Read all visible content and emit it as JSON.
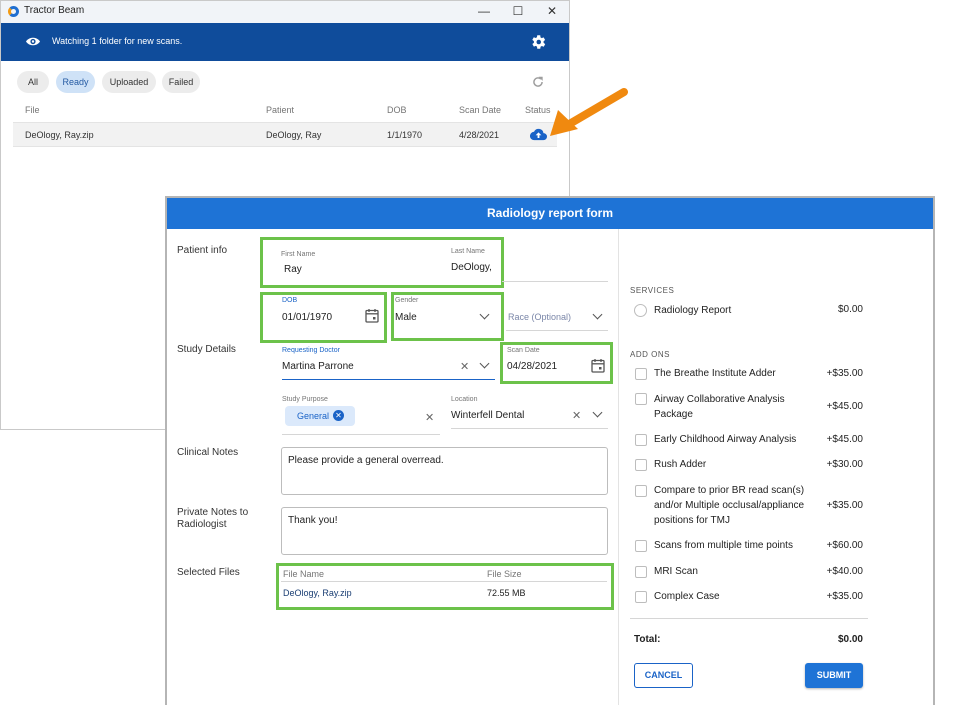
{
  "tractor_beam": {
    "window_title": "Tractor Beam",
    "window_controls": {
      "minimize": "—",
      "maximize": "☐",
      "close": "✕"
    },
    "status_text": "Watching 1 folder for new scans.",
    "filters": [
      "All",
      "Ready",
      "Uploaded",
      "Failed"
    ],
    "active_filter": "Ready",
    "columns": [
      "File",
      "Patient",
      "DOB",
      "Scan Date",
      "Status"
    ],
    "rows": [
      {
        "file": "DeOlogy, Ray.zip",
        "patient": "DeOlogy, Ray",
        "dob": "1/1/1970",
        "scan_date": "4/28/2021",
        "status_icon": "cloud-upload-icon"
      }
    ],
    "icons": {
      "watch": "eye-icon",
      "settings": "gear-icon",
      "refresh": "refresh-icon",
      "callout": "arrow-pointer"
    },
    "colors": {
      "app_bar": "#0f4c9b",
      "callout_arrow": "#f0890f"
    }
  },
  "form": {
    "title": "Radiology report form",
    "sections": {
      "patient_info": "Patient info",
      "study_details": "Study Details",
      "clinical_notes": "Clinical Notes",
      "private_notes": "Private Notes to Radiologist",
      "selected_files": "Selected Files"
    },
    "patient": {
      "first_name_label": "First Name",
      "first_name": "Ray",
      "last_name_label": "Last Name",
      "last_name": "DeOlogy,",
      "dob_label": "DOB",
      "dob": "01/01/1970",
      "gender_label": "Gender",
      "gender": "Male",
      "race_placeholder": "Race (Optional)"
    },
    "study": {
      "doctor_label": "Requesting Doctor",
      "doctor": "Martina Parrone",
      "scan_date_label": "Scan Date",
      "scan_date": "04/28/2021",
      "purpose_label": "Study Purpose",
      "purpose_chip": "General",
      "location_label": "Location",
      "location": "Winterfell Dental"
    },
    "clinical_notes": "Please provide a general overread.",
    "private_notes": "Thank you!",
    "files": {
      "columns": [
        "File Name",
        "File Size"
      ],
      "rows": [
        {
          "name": "DeOlogy, Ray.zip",
          "size": "72.55 MB"
        }
      ]
    },
    "services_heading": "SERVICES",
    "services": [
      {
        "label": "Radiology Report",
        "price": "$0.00"
      }
    ],
    "addons_heading": "ADD ONS",
    "addons": [
      {
        "label": "The Breathe Institute Adder",
        "price": "+$35.00"
      },
      {
        "label": "Airway Collaborative Analysis Package",
        "price": "+$45.00"
      },
      {
        "label": "Early Childhood Airway Analysis",
        "price": "+$45.00"
      },
      {
        "label": "Rush Adder",
        "price": "+$30.00"
      },
      {
        "label": "Compare to prior BR read scan(s) and/or Multiple occlusal/appliance positions for TMJ",
        "price": "+$35.00"
      },
      {
        "label": "Scans from multiple time points",
        "price": "+$60.00"
      },
      {
        "label": "MRI Scan",
        "price": "+$40.00"
      },
      {
        "label": "Complex Case",
        "price": "+$35.00"
      }
    ],
    "total_label": "Total:",
    "total_value": "$0.00",
    "cancel_label": "CANCEL",
    "submit_label": "SUBMIT",
    "colors": {
      "header": "#1e73d6",
      "highlight_box": "#6cc24a",
      "primary": "#1a63c7"
    }
  }
}
